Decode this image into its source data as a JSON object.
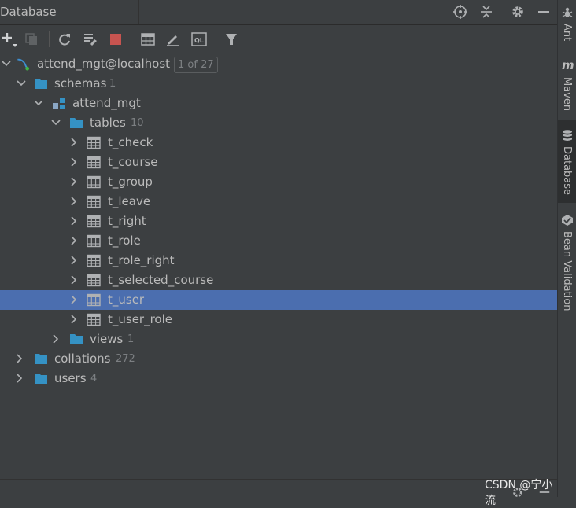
{
  "header": {
    "title": "Database"
  },
  "tree": {
    "connection": {
      "label": "attend_mgt@localhost",
      "badge": "1 of 27"
    },
    "schemas": {
      "label": "schemas",
      "count": "1"
    },
    "schema": {
      "label": "attend_mgt"
    },
    "tables": {
      "label": "tables",
      "count": "10"
    },
    "table_items": [
      "t_check",
      "t_course",
      "t_group",
      "t_leave",
      "t_right",
      "t_role",
      "t_role_right",
      "t_selected_course",
      "t_user",
      "t_user_role"
    ],
    "selected_table": "t_user",
    "views": {
      "label": "views",
      "count": "1"
    },
    "collations": {
      "label": "collations",
      "count": "272"
    },
    "users": {
      "label": "users",
      "count": "4"
    }
  },
  "side_tabs": {
    "ant": "Ant",
    "maven": "Maven",
    "database": "Database",
    "bean": "Bean Validation"
  },
  "watermark": "CSDN @宁小流",
  "colors": {
    "selection": "#4b6eaf",
    "folder": "#3592c4",
    "stop": "#c75450",
    "background": "#3c3f41"
  }
}
